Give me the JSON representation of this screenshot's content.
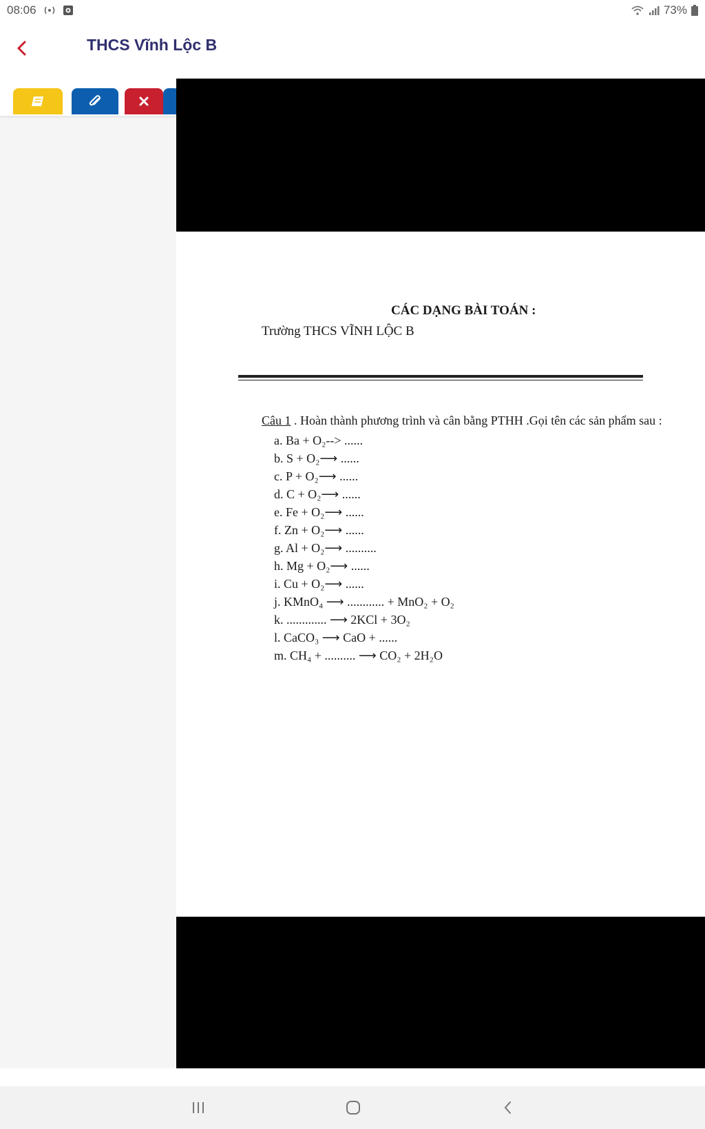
{
  "status_bar": {
    "time": "08:06",
    "battery": "73%"
  },
  "header": {
    "title": "THCS Vĩnh Lộc B"
  },
  "toolbar": {
    "buttons": [
      {
        "icon": "notebook-icon",
        "color": "#f5c518"
      },
      {
        "icon": "paperclip-icon",
        "color": "#0d5eaf"
      },
      {
        "icon": "close-icon",
        "color": "#c8202f"
      }
    ]
  },
  "document": {
    "title": "CÁC DẠNG BÀI TOÁN :",
    "school": "Trường THCS VĨNH LỘC B",
    "question_label": "Câu 1",
    "question_text": " . Hoàn thành phương trình và cân bằng PTHH .Gọi tên các sản phẩm sau :",
    "items": [
      "a. Ba  + O₂--> ......",
      "b. S  + O₂⟶ ......",
      "c. P  + O₂⟶ ......",
      "d. C  + O₂⟶ ......",
      "e. Fe  + O₂⟶ ......",
      "f. Zn  + O₂⟶ ......",
      "g. Al + O₂⟶ ..........",
      "h. Mg + O₂⟶ ......",
      "i. Cu  + O₂⟶ ......",
      "j. KMnO₄  ⟶ ............ + MnO₂ + O₂",
      "k. ............. ⟶ 2KCl + 3O₂",
      "l. CaCO₃ ⟶ CaO + ......",
      "m. CH₄ + .......... ⟶ CO₂ + 2H₂O"
    ]
  },
  "colors": {
    "accent": "#2f2f6e",
    "back_arrow": "#c8202f",
    "viewer_bg": "#000000"
  }
}
